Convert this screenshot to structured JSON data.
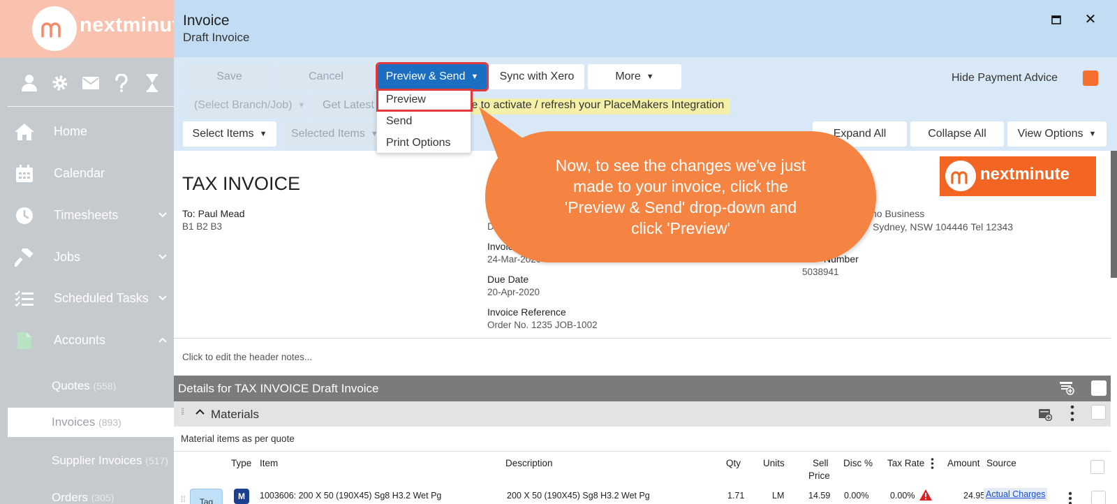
{
  "sidebar": {
    "logo_text": "nextminut",
    "top_icons": [
      "user-icon",
      "gear-icon",
      "mail-icon",
      "help-icon",
      "hourglass-icon"
    ],
    "nav": [
      {
        "label": "Home",
        "icon": "home-icon"
      },
      {
        "label": "Calendar",
        "icon": "calendar-icon"
      },
      {
        "label": "Timesheets",
        "icon": "clock-icon"
      },
      {
        "label": "Jobs",
        "icon": "hammer-icon"
      },
      {
        "label": "Scheduled Tasks",
        "icon": "checklist-icon"
      },
      {
        "label": "Accounts",
        "icon": "document-icon"
      }
    ],
    "sub_items": [
      {
        "label": "Quotes",
        "count": "(558)"
      },
      {
        "label": "Invoices",
        "count": "(893)"
      },
      {
        "label": "Supplier Invoices",
        "count": "(517)"
      },
      {
        "label": "Orders",
        "count": "(305)"
      }
    ]
  },
  "window": {
    "title": "Invoice",
    "subtitle": "Draft Invoice"
  },
  "toolbar": {
    "save": "Save",
    "cancel": "Cancel",
    "preview_send": "Preview & Send",
    "sync_xero": "Sync with Xero",
    "more": "More",
    "select_branch": "(Select Branch/Job)",
    "get_latest": "Get Latest",
    "select_items": "Select Items",
    "selected_items": "Selected Items",
    "expand_all": "Expand All",
    "collapse_all": "Collapse All",
    "view_options": "View Options",
    "hide_payment_advice": "Hide Payment Advice",
    "placemakers_banner": "re to activate / refresh your PlaceMakers Integration",
    "accent_color": "#1b6ec2",
    "toggle_color": "#f56f2f"
  },
  "dropdown": {
    "items": [
      "Preview",
      "Send",
      "Print Options"
    ]
  },
  "callout": {
    "text": "Now, to see the changes we've just made to your invoice, click the 'Preview & Send' drop-down and click 'Preview'",
    "color": "#f58342"
  },
  "document": {
    "title": "TAX INVOICE",
    "to_label": "To: Paul Mead",
    "to_address": "B1 B2 B3",
    "col2_label_partial": "I",
    "col2_value_partial": "D",
    "invoice_date_label": "Invoic",
    "invoice_date": "24-Mar-2020",
    "due_date_label": "Due Date",
    "due_date": "20-Apr-2020",
    "reference_label": "Invoice Reference",
    "reference": "Order No. 1235 JOB-1002",
    "business_name": "no Business",
    "business_address": "Sydney, NSW 104446 Tel 12343",
    "gst_label": "Number",
    "gst_number": "5038941",
    "logo_text": "nextminute",
    "header_notes": "Click to edit the header notes..."
  },
  "details": {
    "title": "Details for TAX INVOICE Draft Invoice",
    "group_title": "Materials",
    "group_note": "Material items as per quote",
    "columns": {
      "type": "Type",
      "item": "Item",
      "description": "Description",
      "qty": "Qty",
      "units": "Units",
      "sell_price_1": "Sell",
      "sell_price_2": "Price",
      "disc": "Disc %",
      "tax_rate": "Tax Rate",
      "amount": "Amount",
      "source": "Source"
    },
    "rows": [
      {
        "tag": "Tag",
        "type": "M",
        "item": "1003606: 200 X 50 (190X45) Sg8 H3.2 Wet Pg",
        "description": "200 X 50 (190X45) Sg8 H3.2 Wet Pg",
        "qty": "1.71",
        "units": "LM",
        "sell_price": "14.59",
        "disc": "0.00%",
        "tax_rate": "0.00%",
        "amount": "24.95",
        "source": "Actual Charges"
      }
    ]
  }
}
